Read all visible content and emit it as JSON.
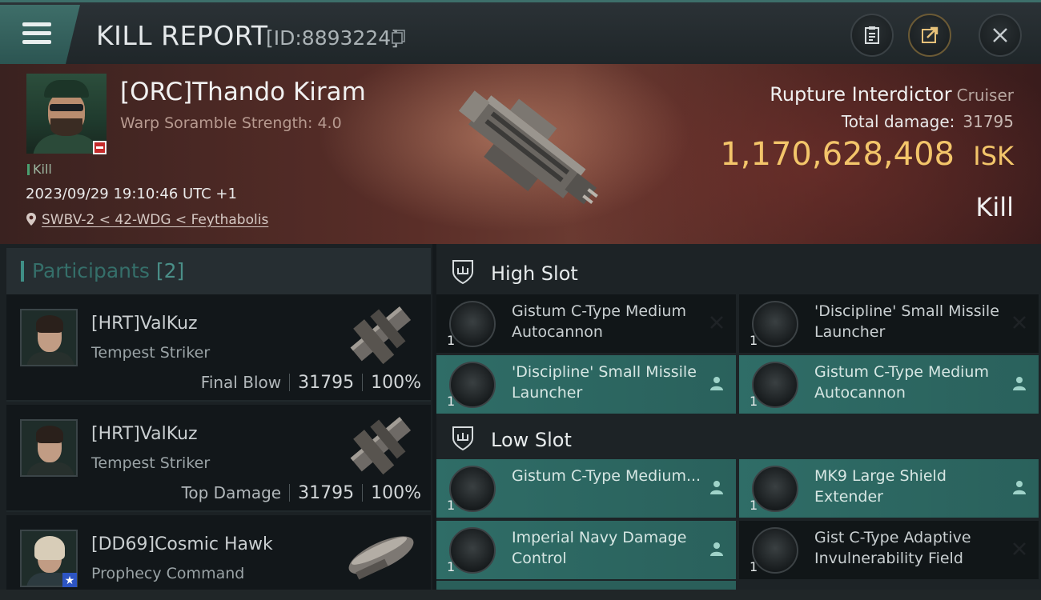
{
  "header": {
    "title": "KILL REPORT",
    "report_id": "[ID:8893224]"
  },
  "victim": {
    "name": "[ORC]Thando Kiram",
    "subtitle": "Warp Soramble Strength: 4.0",
    "tag": "Kill",
    "timestamp": "2023/09/29 19:10:46 UTC +1",
    "location": "SWBV-2 < 42-WDG < Feythabolis",
    "ship": "Rupture Interdictor",
    "ship_class": "Cruiser",
    "total_damage_label": "Total damage:",
    "total_damage": "31795",
    "isk_value": "1,170,628,408",
    "isk_unit": "ISK",
    "result": "Kill"
  },
  "participants": {
    "title": "Participants",
    "count": "[2]",
    "rows": [
      {
        "name": "[HRT]ValKuz",
        "ship": "Tempest Striker",
        "role": "Final Blow",
        "damage": "31795",
        "percent": "100%"
      },
      {
        "name": "[HRT]ValKuz",
        "ship": "Tempest Striker",
        "role": "Top Damage",
        "damage": "31795",
        "percent": "100%"
      },
      {
        "name": "[DD69]Cosmic Hawk",
        "ship": "Prophecy Command"
      }
    ]
  },
  "fitting": {
    "high_slot_label": "High Slot",
    "low_slot_label": "Low Slot",
    "high": [
      {
        "name": "Gistum C-Type Medium Autocannon",
        "qty": "1",
        "state": "destroyed"
      },
      {
        "name": "'Discipline' Small Missile Launcher",
        "qty": "1",
        "state": "destroyed"
      },
      {
        "name": "'Discipline' Small Missile Launcher",
        "qty": "1",
        "state": "dropped"
      },
      {
        "name": "Gistum C-Type Medium Autocannon",
        "qty": "1",
        "state": "dropped"
      }
    ],
    "low": [
      {
        "name": "Gistum C-Type Medium...",
        "qty": "1",
        "state": "dropped"
      },
      {
        "name": "MK9 Large Shield Extender",
        "qty": "1",
        "state": "dropped"
      },
      {
        "name": "Imperial Navy Damage Control",
        "qty": "1",
        "state": "dropped"
      },
      {
        "name": "Gist C-Type Adaptive Invulnerability Field",
        "qty": "1",
        "state": "destroyed"
      }
    ]
  },
  "colors": {
    "accent": "#3f8f86",
    "isk": "#f3c56a",
    "dropped_bg": "#2f6d67"
  }
}
